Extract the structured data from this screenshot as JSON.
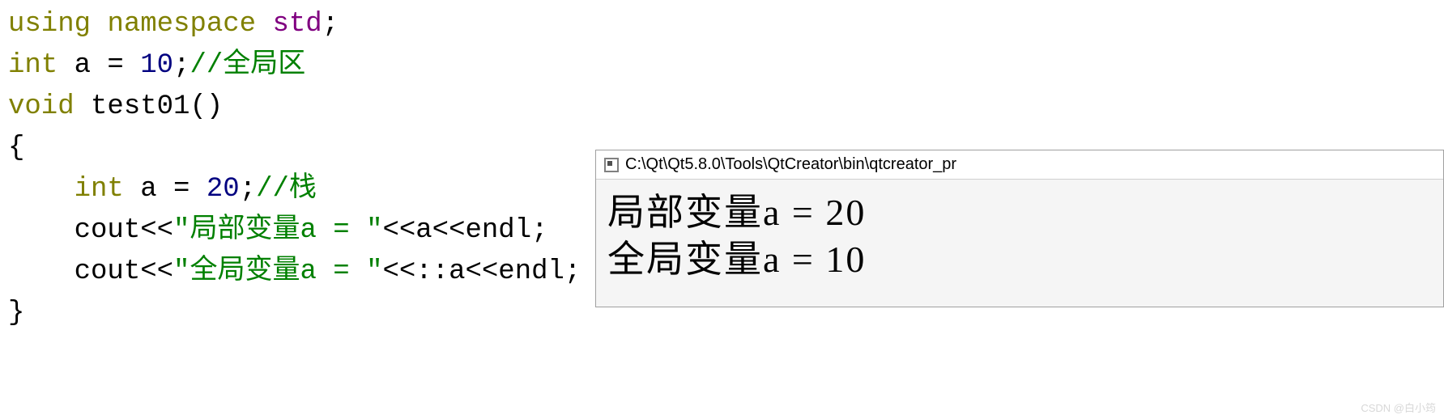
{
  "code": {
    "line1": {
      "kw1": "using",
      "kw2": "namespace",
      "id": "std",
      "semi": ";"
    },
    "line2": {
      "type": "int",
      "name": " a = ",
      "val": "10",
      "semi": ";",
      "comment": "//全局区"
    },
    "line3": {
      "type": "void",
      "name": " test01()"
    },
    "line4": "{",
    "line5": {
      "indent": "    ",
      "type": "int",
      "name": " a = ",
      "val": "20",
      "semi": ";",
      "comment": "//栈"
    },
    "line6": {
      "indent": "    ",
      "pre": "cout<<",
      "str": "\"局部变量a = \"",
      "post": "<<a<<endl;"
    },
    "line7": {
      "indent": "    ",
      "pre": "cout<<",
      "str": "\"全局变量a = \"",
      "post": "<<::a<<endl;"
    },
    "line8": "}"
  },
  "console": {
    "title": "C:\\Qt\\Qt5.8.0\\Tools\\QtCreator\\bin\\qtcreator_pr",
    "out1": "局部变量a = 20",
    "out2": "全局变量a = 10"
  },
  "watermark": "CSDN @白小筠"
}
